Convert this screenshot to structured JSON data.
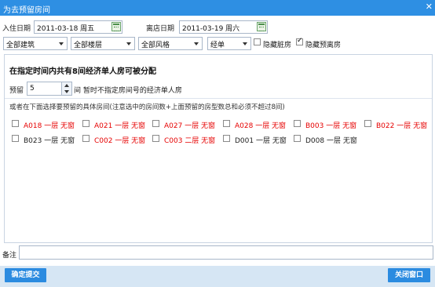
{
  "window": {
    "title": "为去预留房间",
    "close_glyph": "✕"
  },
  "dates": {
    "checkin_label": "入住日期",
    "checkin_value": "2011-03-18 周五",
    "checkout_label": "离店日期",
    "checkout_value": "2011-03-19 周六"
  },
  "filters": {
    "building": "全部建筑",
    "floor": "全部楼层",
    "style": "全部风格",
    "room_type": "经单",
    "hide_dirty_label": "隐藏脏房",
    "hide_dirty_checked": false,
    "hide_reserved_label": "隐藏预离房",
    "hide_reserved_checked": true
  },
  "panel": {
    "heading": "在指定时间内共有8间经济单人房可被分配",
    "reserve_label": "预留",
    "reserve_value": "5",
    "reserve_text": "间 暂时不指定房间号的经济单人房",
    "instruction": "或者在下面选择要预留的具体房间(注意选中的房间数+上面预留的房型数总和必须不超过8间)"
  },
  "rooms": [
    {
      "label": "A018 一层 无窗",
      "color": "red"
    },
    {
      "label": "A021 一层 无窗",
      "color": "red"
    },
    {
      "label": "A027 一层 无窗",
      "color": "red"
    },
    {
      "label": "A028 一层 无窗",
      "color": "red"
    },
    {
      "label": "B003 一层 无窗",
      "color": "red"
    },
    {
      "label": "B022 一层 无窗",
      "color": "red"
    },
    {
      "label": "B023 一层 无窗",
      "color": "black"
    },
    {
      "label": "C002 一层 无窗",
      "color": "red"
    },
    {
      "label": "C003 二层 无窗",
      "color": "red"
    },
    {
      "label": "D001 一层 无窗",
      "color": "black"
    },
    {
      "label": "D008 一层 无窗",
      "color": "black"
    }
  ],
  "note": {
    "label": "备注",
    "value": ""
  },
  "footer": {
    "submit_label": "确定提交",
    "close_label": "关闭窗口"
  },
  "colors": {
    "titlebar": "#2e8fe3",
    "button": "#2b8be0",
    "red_room": "#e60000",
    "footer": "#d6e6f4"
  }
}
